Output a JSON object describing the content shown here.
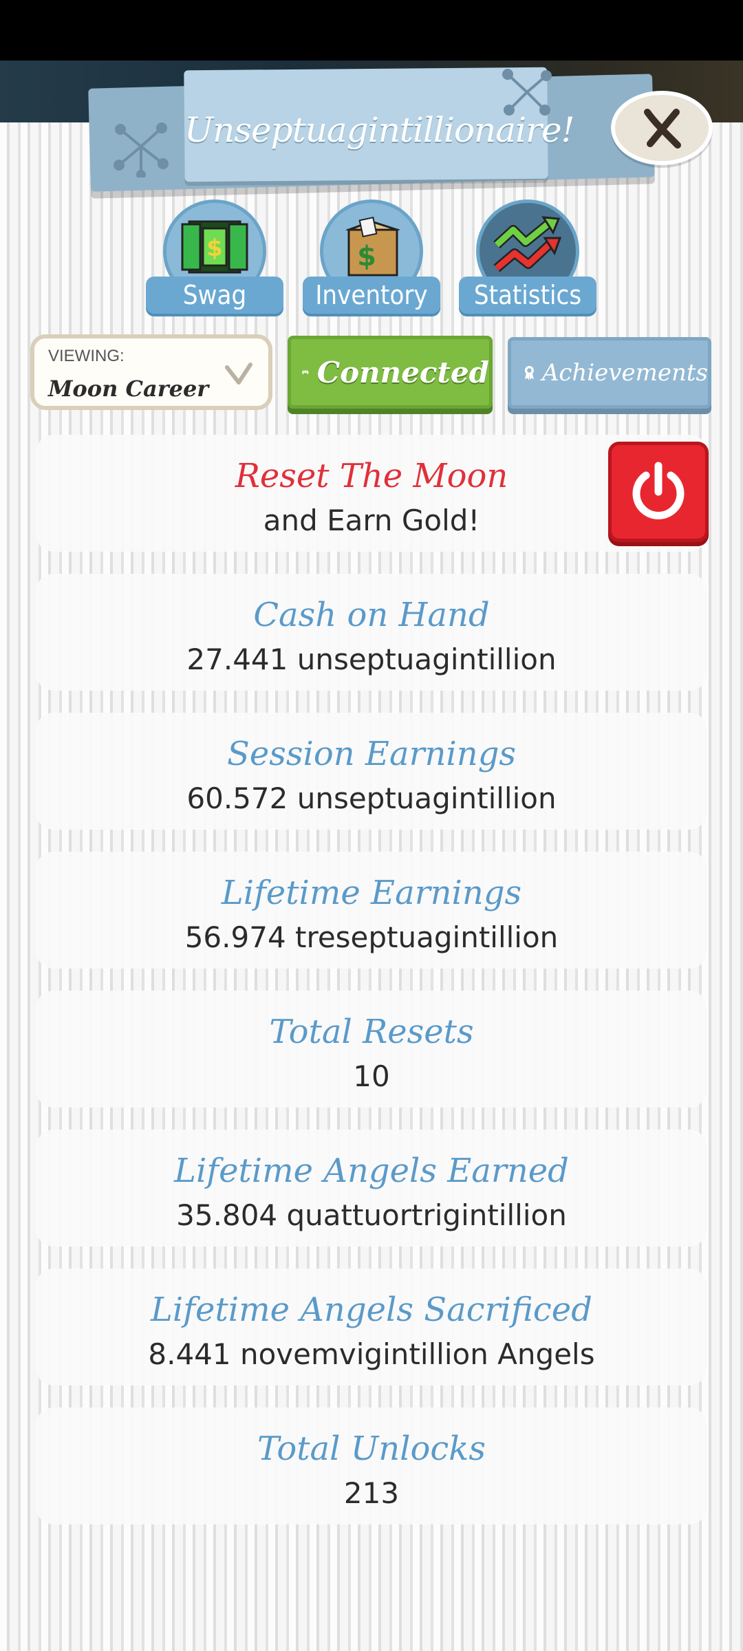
{
  "header": {
    "title": "Unseptuagintillionaire!",
    "close_icon": "close-x-icon"
  },
  "tabs": [
    {
      "label": "Swag",
      "icon": "money-door-icon"
    },
    {
      "label": "Inventory",
      "icon": "money-box-icon"
    },
    {
      "label": "Statistics",
      "icon": "stock-arrows-icon"
    }
  ],
  "viewing": {
    "label": "VIEWING:",
    "value": "Moon Career"
  },
  "buttons": {
    "connected": "Connected",
    "achievements": "Achievements"
  },
  "reset": {
    "title": "Reset The Moon",
    "subtitle": "and Earn Gold!"
  },
  "stats": [
    {
      "title": "Cash on Hand",
      "value": "27.441 unseptuagintillion"
    },
    {
      "title": "Session Earnings",
      "value": "60.572 unseptuagintillion"
    },
    {
      "title": "Lifetime Earnings",
      "value": "56.974 treseptuagintillion"
    },
    {
      "title": "Total Resets",
      "value": "10"
    },
    {
      "title": "Lifetime Angels Earned",
      "value": "35.804 quattuortrigintillion"
    },
    {
      "title": "Lifetime Angels Sacrificed",
      "value": "8.441 novemvigintillion Angels"
    },
    {
      "title": "Total Unlocks",
      "value": "213"
    }
  ],
  "colors": {
    "accent_blue": "#5a9ac9",
    "reset_red": "#e0303a",
    "connected_green": "#7fbc42"
  }
}
